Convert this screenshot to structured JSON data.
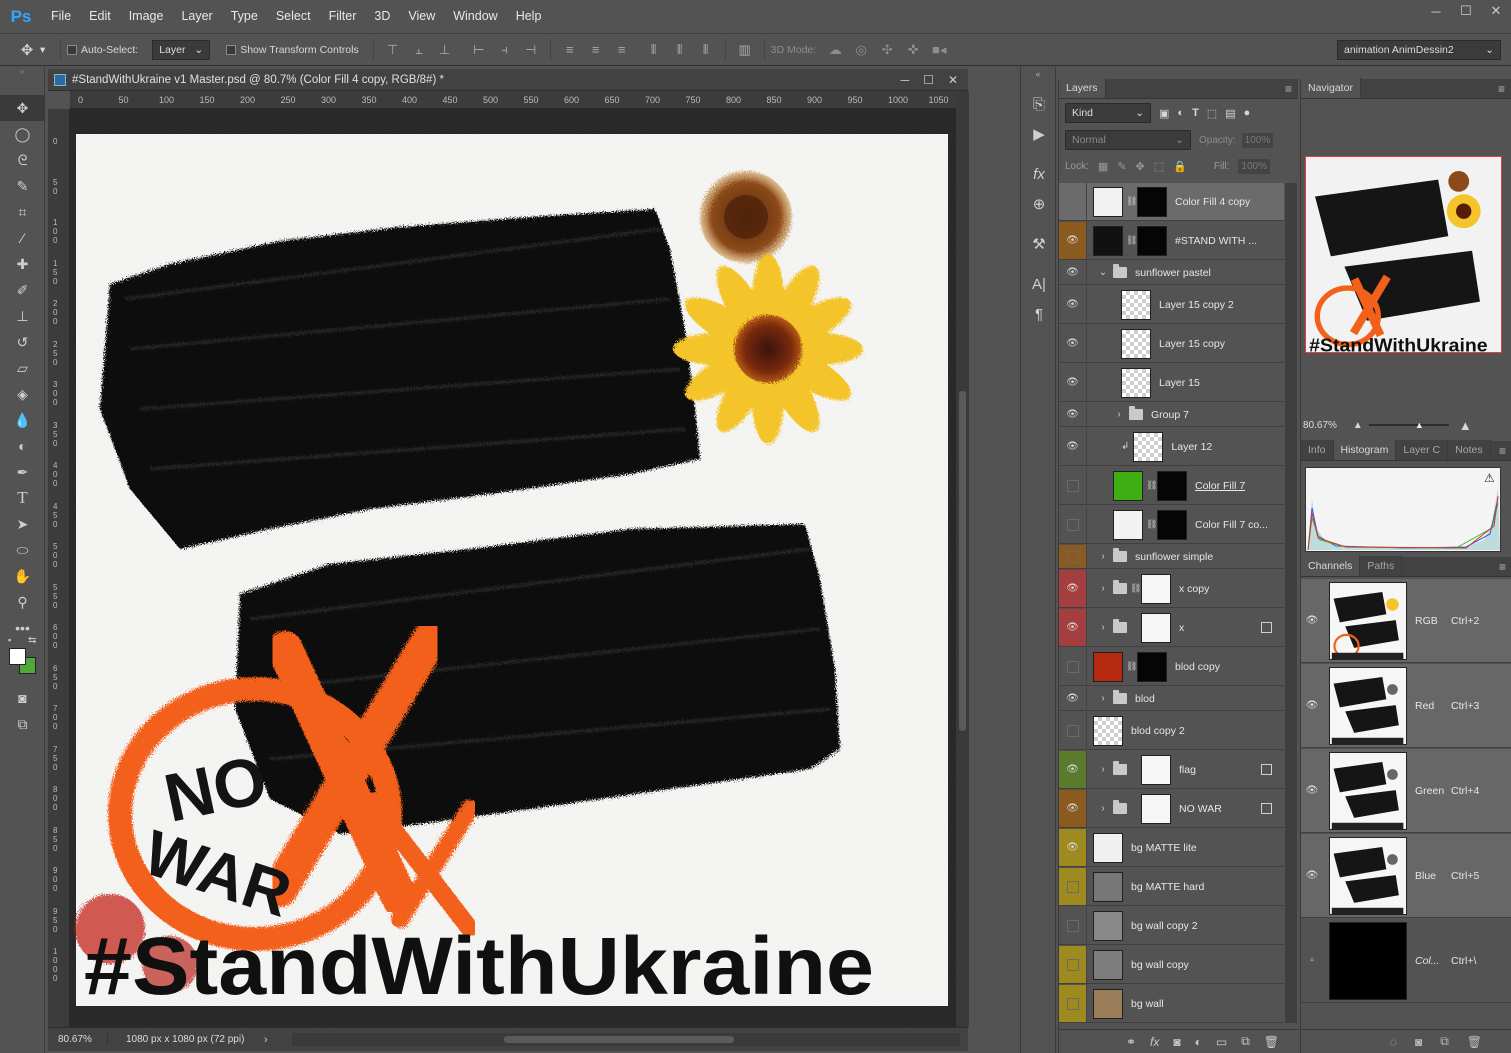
{
  "app": {
    "logo": "Ps",
    "menu": [
      "File",
      "Edit",
      "Image",
      "Layer",
      "Type",
      "Select",
      "Filter",
      "3D",
      "View",
      "Window",
      "Help"
    ],
    "window_controls": [
      "─",
      "☐",
      "✕"
    ]
  },
  "options_bar": {
    "auto_select_label": "Auto-Select:",
    "auto_select_value": "Layer",
    "show_transform_label": "Show Transform Controls",
    "mode_3d_label": "3D Mode:",
    "workspace": "animation AnimDessin2"
  },
  "document": {
    "title": "#StandWithUkraine v1 Master.psd @ 80.7% (Color Fill 4 copy, RGB/8#) *",
    "ruler_ticks": [
      "0",
      "50",
      "100",
      "150",
      "200",
      "250",
      "300",
      "350",
      "400",
      "450",
      "500",
      "550",
      "600",
      "650",
      "700",
      "750",
      "800",
      "850",
      "900",
      "950",
      "1000",
      "1050"
    ],
    "left_ruler": [
      "0",
      "5 0",
      "1 0 0",
      "1 5 0",
      "2 0 0",
      "2 5 0",
      "3 0 0",
      "3 5 0",
      "4 0 0",
      "4 5 0",
      "5 0 0",
      "5 5 0",
      "6 0 0",
      "6 5 0",
      "7 0 0",
      "7 5 0",
      "8 0 0",
      "8 5 0",
      "9 0 0",
      "9 5 0",
      "1 0 0 0"
    ],
    "zoom": "80.67%",
    "size": "1080 px x 1080 px (72 ppi)",
    "artwork": {
      "hashtag": "#StandWithUkraine",
      "no": "NO",
      "war": "WAR"
    }
  },
  "layers_panel": {
    "tab": "Layers",
    "filter_kind": "Kind",
    "blend_mode": "Normal",
    "opacity_label": "Opacity:",
    "opacity_value": "100%",
    "lock_label": "Lock:",
    "fill_label": "Fill:",
    "fill_value": "100%",
    "layers": [
      {
        "name": "Color Fill 4 copy",
        "eye": false,
        "color": "",
        "selected": true
      },
      {
        "name": "#STAND WITH ...",
        "eye": true,
        "color": "#8a5a1e"
      },
      {
        "name": "sunflower pastel",
        "eye": true,
        "color": ""
      },
      {
        "name": "Layer 15 copy 2",
        "eye": true,
        "color": ""
      },
      {
        "name": "Layer 15 copy",
        "eye": true,
        "color": ""
      },
      {
        "name": "Layer 15",
        "eye": true,
        "color": ""
      },
      {
        "name": "Group 7",
        "eye": true,
        "color": ""
      },
      {
        "name": "Layer 12",
        "eye": true,
        "color": ""
      },
      {
        "name": "Color Fill 7",
        "eye": false,
        "color": ""
      },
      {
        "name": "Color Fill 7 co...",
        "eye": false,
        "color": ""
      },
      {
        "name": "sunflower simple",
        "eye": false,
        "color": "#8a5a1e"
      },
      {
        "name": "x copy",
        "eye": true,
        "color": "#a53f3f"
      },
      {
        "name": "x",
        "eye": true,
        "color": "#a53f3f"
      },
      {
        "name": "blod copy",
        "eye": false,
        "color": ""
      },
      {
        "name": "blod",
        "eye": true,
        "color": ""
      },
      {
        "name": "blod copy 2",
        "eye": false,
        "color": ""
      },
      {
        "name": "flag",
        "eye": true,
        "color": "#5c7a2e"
      },
      {
        "name": "NO WAR",
        "eye": true,
        "color": "#8a5a1e"
      },
      {
        "name": "bg MATTE lite",
        "eye": true,
        "color": "#9e8a1f"
      },
      {
        "name": "bg MATTE hard",
        "eye": false,
        "color": "#9e8a1f"
      },
      {
        "name": "bg wall  copy 2",
        "eye": false,
        "color": ""
      },
      {
        "name": "bg wall  copy",
        "eye": false,
        "color": "#9e8a1f"
      },
      {
        "name": "bg wall",
        "eye": false,
        "color": "#9e8a1f"
      }
    ]
  },
  "navigator": {
    "tab": "Navigator",
    "zoom": "80.67%"
  },
  "info_tabs": [
    "Info",
    "Histogram",
    "Layer C",
    "Notes"
  ],
  "channels_panel": {
    "tabs": [
      "Channels",
      "Paths"
    ],
    "channels": [
      {
        "name": "RGB",
        "key": "Ctrl+2"
      },
      {
        "name": "Red",
        "key": "Ctrl+3"
      },
      {
        "name": "Green",
        "key": "Ctrl+4"
      },
      {
        "name": "Blue",
        "key": "Ctrl+5"
      },
      {
        "name": "Col...",
        "key": "Ctrl+\\"
      }
    ]
  }
}
